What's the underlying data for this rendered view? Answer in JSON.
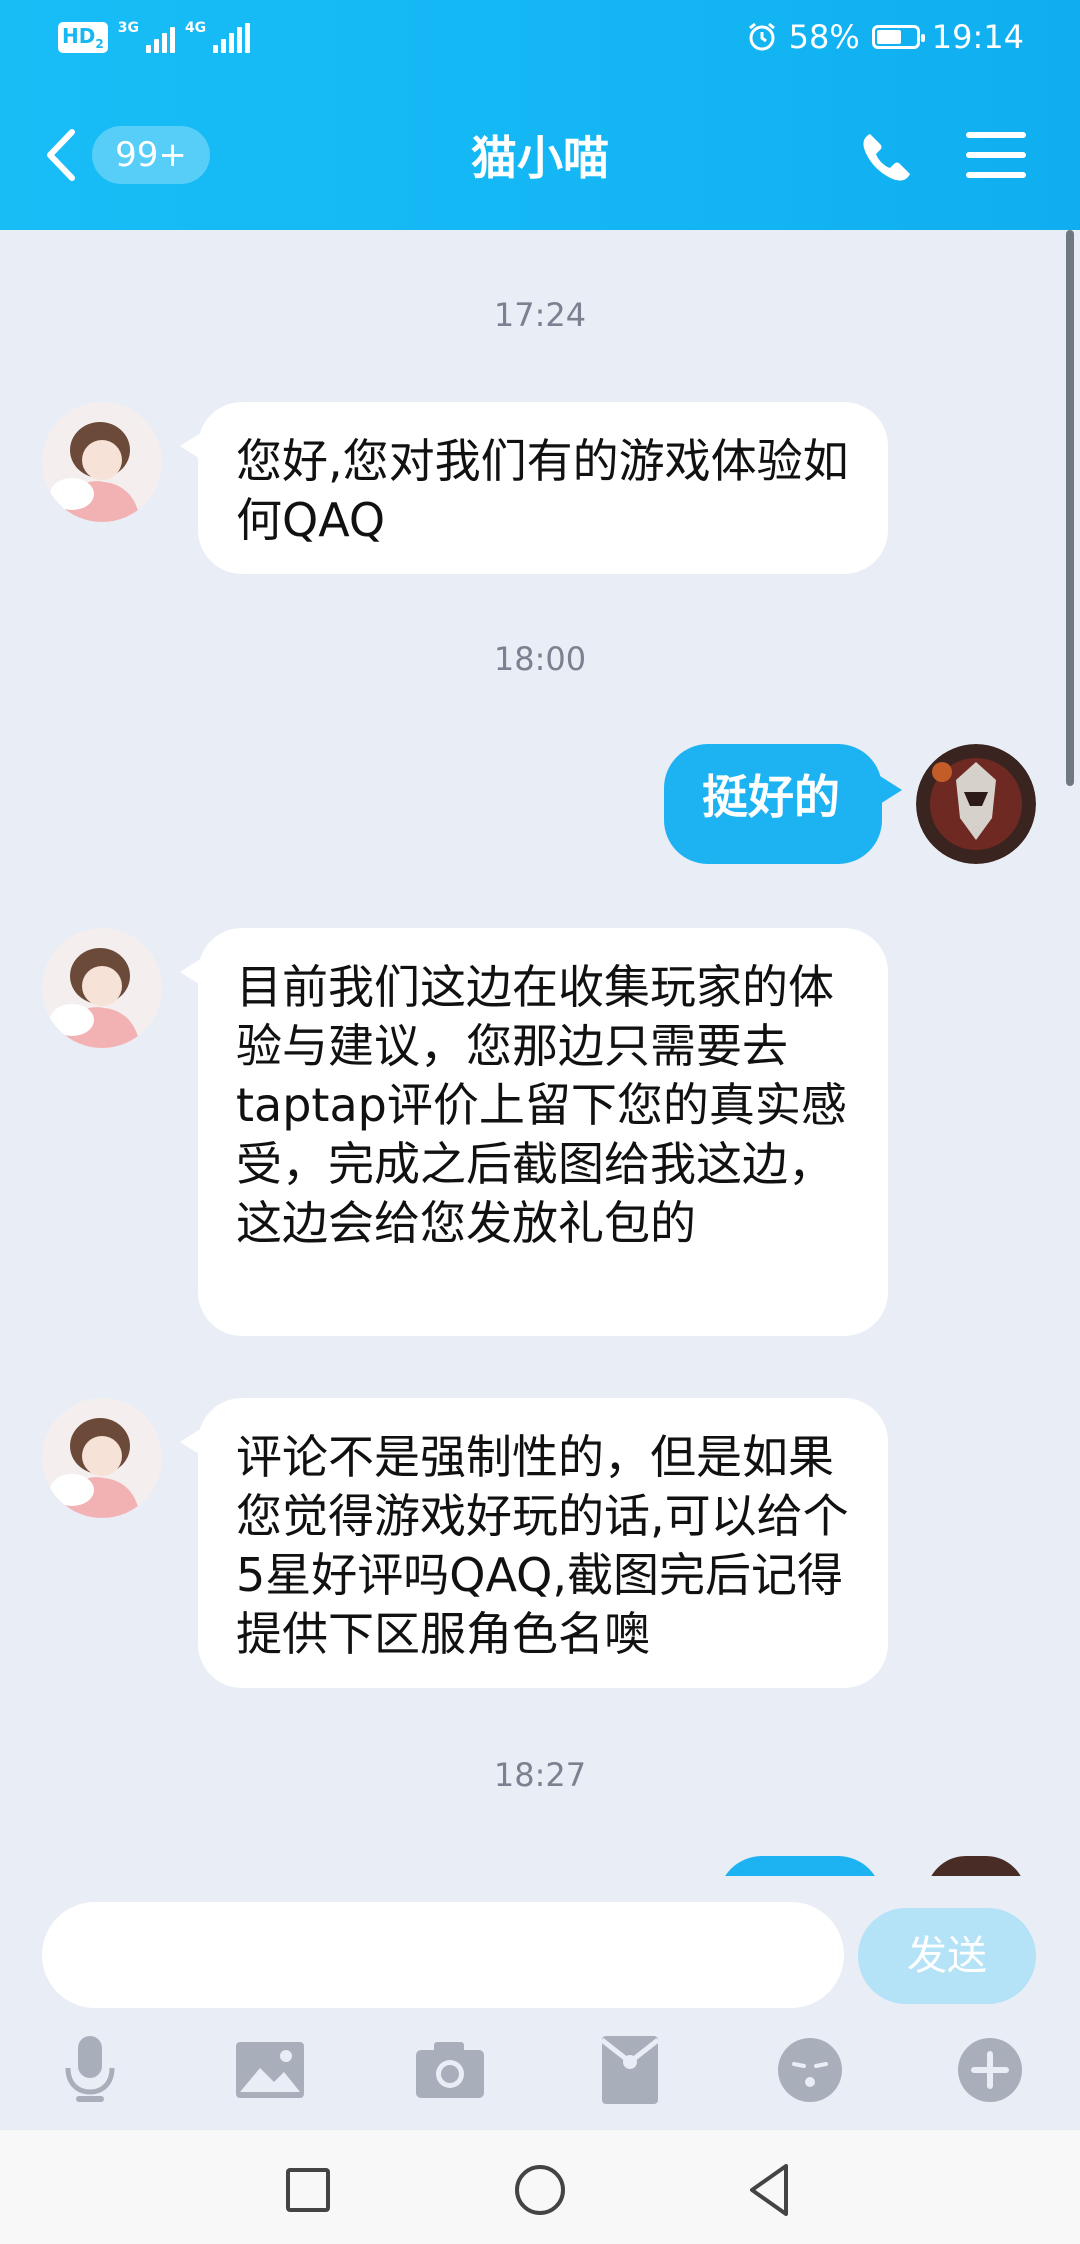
{
  "status_bar": {
    "hd_label": "HD",
    "sim_index": "2",
    "net1": "3G",
    "net2": "4G",
    "battery_text": "58%",
    "battery_level": 0.58,
    "time": "19:14"
  },
  "header": {
    "unread_count": "99+",
    "title": "猫小喵"
  },
  "messages": [
    {
      "type": "time",
      "text": "17:24"
    },
    {
      "type": "incoming",
      "text": "您好,您对我们有的游戏体验如何QAQ"
    },
    {
      "type": "time",
      "text": "18:00"
    },
    {
      "type": "outgoing",
      "text": "挺好的"
    },
    {
      "type": "incoming",
      "text": "目前我们这边在收集玩家的体验与建议，您那边只需要去taptap评价上留下您的真实感受，完成之后截图给我这边，这边会给您发放礼包的"
    },
    {
      "type": "incoming",
      "text": "评论不是强制性的，但是如果您觉得游戏好玩的话,可以给个5星好评吗QAQ,截图完后记得提供下区服角色名噢"
    },
    {
      "type": "time",
      "text": "18:27"
    }
  ],
  "input": {
    "value": "",
    "placeholder": "",
    "send_label": "发送"
  },
  "toolbar_icons": [
    "microphone-icon",
    "image-icon",
    "camera-icon",
    "red-packet-icon",
    "emoji-icon",
    "plus-icon"
  ],
  "colors": {
    "header_bg": "#16b8f4",
    "chat_bg": "#e9edf6",
    "outgoing_bubble": "#1db3f3",
    "incoming_bubble": "#ffffff",
    "send_disabled": "#b4e2f6"
  }
}
